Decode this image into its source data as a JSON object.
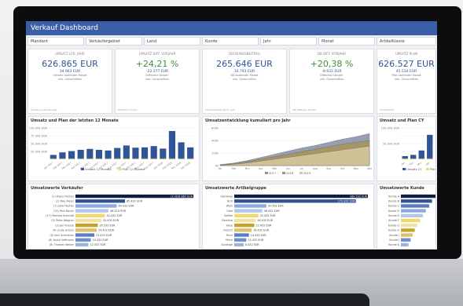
{
  "dashboard": {
    "title": "Verkauf Dashboard",
    "filters": [
      {
        "label": "Mandant"
      },
      {
        "label": "Verkäufergebiet"
      },
      {
        "label": "Land"
      },
      {
        "label": "Kunde"
      },
      {
        "label": "Jahr"
      },
      {
        "label": "Monat"
      },
      {
        "label": "Artikelklasse"
      }
    ]
  },
  "kpis": [
    {
      "head": "UMSATZ LFD. JAHR",
      "value": "626.865 EUR",
      "sub": "34.963 EUR",
      "tiny1": "Umsatz laufender Monat",
      "tiny2": "inkl. Gutschriften",
      "foot": "Umsatz laufendes Jahr",
      "color": "#2f5597"
    },
    {
      "head": "UMSATZ DIFF. VORJAHR",
      "value": "+24,21 %",
      "sub": "-22.377 EUR",
      "tiny1": "Differenz Vorjahr",
      "tiny2": "inkl. Gutschriften",
      "foot": "Differenz Vorjahr",
      "color": "#3f8f3f"
    },
    {
      "head": "DECKUNGSBEITRAG",
      "value": "265.646 EUR",
      "sub": "10.793 EUR",
      "tiny1": "DB laufender Monat",
      "tiny2": "inkl. Gutschriften",
      "foot": "Deckungsbeitrag lfd. Jahr",
      "color": "#2f5597"
    },
    {
      "head": "DB DIFF. VORJAHR",
      "value": "+20,38 %",
      "sub": "-8.932 EUR",
      "tiny1": "Differenz Vorjahr",
      "tiny2": "inkl. Gutschriften",
      "foot": "DB Differenz Vorjahr",
      "color": "#3f8f3f"
    },
    {
      "head": "UMSATZ PLAN",
      "value": "626.527 EUR",
      "sub": "45.534 EUR",
      "tiny1": "Plan laufender Monat",
      "tiny2": "inkl. Gutschriften",
      "foot": "Umsatz Plan",
      "color": "#2f5597"
    }
  ],
  "panels": {
    "bar_title": "Umsatz und Plan der letzten 12 Monate",
    "area_title": "Umsatzentwicklung kumuliert pro Jahr",
    "bar_right_title": "Umsatz und Plan CY",
    "h1_title": "Umsatzwerte Verkäufer",
    "h2_title": "Umsatzwerte Artikelgruppe",
    "h3_title": "Umsatzwerte Kunde"
  },
  "chart_data": [
    {
      "type": "bar",
      "title": "Umsatz und Plan der letzten 12 Monate",
      "categories": [
        "Jan 2017",
        "Feb 2017",
        "Mrz 2017",
        "Apr 2017",
        "Mai 2017",
        "Jun 2017",
        "Jul 2017",
        "Aug 2017",
        "Sep 2017",
        "Okt 2017",
        "Nov 2017",
        "Dez 2017",
        "Jan 2018",
        "Feb 2018",
        "Mrz 2018",
        "Apr 2018"
      ],
      "y_ticks": [
        "100.000 EUR",
        "75.000 EUR",
        "50.000 EUR",
        "25.000 EUR"
      ],
      "ylim": [
        0,
        100000
      ],
      "series": [
        {
          "name": "Umsatz 12 Monate",
          "color": "#2f5597",
          "values": [
            14000,
            22000,
            26000,
            30000,
            33000,
            30000,
            28000,
            36000,
            44000,
            37000,
            38000,
            42000,
            34000,
            90000,
            54000,
            38000
          ]
        },
        {
          "name": "Plan 12 Monate",
          "color": "#f2d66f",
          "values": [
            2000,
            2000,
            2000,
            2000,
            2000,
            2000,
            2000,
            2000,
            2000,
            2000,
            2000,
            2000,
            2000,
            2000,
            2000,
            2000
          ]
        }
      ],
      "legend": "bottom"
    },
    {
      "type": "area",
      "title": "Umsatzentwicklung kumuliert pro Jahr",
      "categories": [
        "Jan",
        "Feb",
        "Mrz",
        "Apr",
        "Mai",
        "Jun",
        "Jul",
        "Aug",
        "Sep",
        "Okt",
        "Nov",
        "Dez"
      ],
      "y_ticks": [
        "600k",
        "400k",
        "200k",
        "0k"
      ],
      "ylim": [
        0,
        600000
      ],
      "series": [
        {
          "name": "2017",
          "color": "#8a95a8",
          "values": [
            15000,
            40000,
            80000,
            130000,
            180000,
            230000,
            280000,
            320000,
            370000,
            420000,
            460000,
            510000
          ]
        },
        {
          "name": "2018",
          "color": "#a89360",
          "values": [
            10000,
            30000,
            60000,
            100000,
            140000,
            180000,
            220000,
            260000,
            300000,
            340000,
            370000,
            400000
          ]
        },
        {
          "name": "2019",
          "color": "#d4c79a",
          "values": [
            5000,
            20000,
            40000,
            70000,
            100000,
            130000,
            160000,
            190000,
            220000,
            250000,
            280000,
            310000
          ]
        }
      ],
      "legend": "bottom"
    },
    {
      "type": "bar",
      "title": "Umsatz und Plan CY",
      "categories": [
        "Jan",
        "Feb",
        "Mrz",
        "Apr"
      ],
      "y_ticks": [
        "100.000 EUR",
        "75.000 EUR",
        "50.000 EUR",
        "25.000 EUR"
      ],
      "ylim": [
        0,
        100000
      ],
      "series": [
        {
          "name": "Umsatz CY",
          "color": "#2f5597",
          "values": [
            10000,
            14000,
            28000,
            78000
          ]
        },
        {
          "name": "Plan CY",
          "color": "#f2d66f",
          "values": [
            2000,
            2000,
            2000,
            2000
          ]
        }
      ],
      "legend": "bottom"
    },
    {
      "type": "bar",
      "orientation": "horizontal",
      "title": "Umsatzwerte Verkäufer",
      "categories": [
        "(1) Klaus Fischer",
        "(2) Max Meier",
        "(7) Julia Fischer",
        "(13) Paul Bauer",
        "(17) Martina Schmidt",
        "(9) Peter Wagner",
        "(3) Jan Krause",
        "(4) Linda Schulz",
        "(5) Karl Schneider",
        "(6) Anna Hoffmann",
        "(8) Thomas Weber"
      ],
      "values_label": [
        "(1) 626.865 EUR",
        "85.432 EUR",
        "64.432 EUR",
        "48.523 EUR",
        "42.432 EUR",
        "32.432 EUR",
        "26.532 EUR",
        "24.432 EUR",
        "21.432 EUR",
        "14.432 EUR",
        "12.432 EUR"
      ],
      "values": [
        100,
        42,
        35,
        28,
        25,
        22,
        19,
        18,
        16,
        13,
        11
      ],
      "colors": [
        "#0e1e3f",
        "#2f5597",
        "#8ea9db",
        "#b4c7e7",
        "#f2d66f",
        "#f4e2a0",
        "#c9a227",
        "#dcc16a",
        "#5b7cbf",
        "#6f8dc8",
        "#9db3dd"
      ]
    },
    {
      "type": "bar",
      "orientation": "horizontal",
      "title": "Umsatzwerte Artikelgruppe",
      "categories": [
        "Getränke",
        "Brot",
        "Wein",
        "Obst",
        "Kaffee",
        "Gemüse",
        "Käse",
        "Fleisch",
        "Fisch",
        "Milch",
        "Sonstige"
      ],
      "values_label": [
        "189.532 EUR",
        "172.432 EUR",
        "42.432 EUR",
        "36.432 EUR",
        "32.432 EUR",
        "26.432 EUR",
        "22.432 EUR",
        "18.432 EUR",
        "14.432 EUR",
        "12.432 EUR",
        "8.432 EUR"
      ],
      "values": [
        100,
        91,
        24,
        21,
        18,
        16,
        15,
        13,
        11,
        9,
        7
      ],
      "colors": [
        "#0e1e3f",
        "#2f5597",
        "#8ea9db",
        "#b4c7e7",
        "#f2d66f",
        "#f4e2a0",
        "#c9a227",
        "#dcc16a",
        "#5b7cbf",
        "#6f8dc8",
        "#9db3dd"
      ]
    },
    {
      "type": "bar",
      "orientation": "horizontal",
      "title": "Umsatzwerte Kunde",
      "categories": [
        "Kunde A",
        "Kunde B",
        "Kunde C",
        "Kunde D",
        "Kunde E",
        "Kunde F",
        "Kunde G",
        "Kunde H",
        "Kunde I",
        "Kunde J",
        "Kunde K"
      ],
      "values_label": [
        "",
        "",
        "",
        "",
        "",
        "",
        "",
        "",
        "",
        "",
        ""
      ],
      "values": [
        100,
        90,
        82,
        72,
        64,
        56,
        48,
        40,
        34,
        28,
        22
      ],
      "colors": [
        "#0e1e3f",
        "#2f5597",
        "#5b7cbf",
        "#8ea9db",
        "#b4c7e7",
        "#f2d66f",
        "#f4e2a0",
        "#c9a227",
        "#dcc16a",
        "#6f8dc8",
        "#9db3dd"
      ]
    }
  ]
}
